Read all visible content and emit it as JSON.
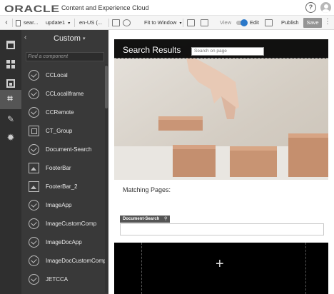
{
  "brand": {
    "logo_text": "ORACLE",
    "product_name": "Content and Experience Cloud",
    "help_icon": "help-icon",
    "avatar_icon": "user-avatar-icon"
  },
  "toolbar": {
    "back_glyph": "‹",
    "page_name": "sear...",
    "update": "update1",
    "update_caret": "▾",
    "locale": "en-US (...",
    "fit": "Fit to Window",
    "fit_caret": "▾",
    "view_label": "View",
    "edit_label": "Edit",
    "publish_label": "Publish",
    "save_label": "Save",
    "more_glyph": "⋮",
    "colors": {
      "toggle_on": "#2a78c9",
      "save_bg": "#949494"
    }
  },
  "rail": {
    "items": [
      {
        "name": "layout",
        "icon": "layout-icon"
      },
      {
        "name": "grid",
        "icon": "grid-icon"
      },
      {
        "name": "image",
        "icon": "image-icon"
      },
      {
        "name": "components",
        "icon": "crop-icon",
        "glyph": "⌗",
        "active": true
      },
      {
        "name": "theme",
        "icon": "brush-icon",
        "glyph": "✎"
      },
      {
        "name": "settings",
        "icon": "gear-icon",
        "glyph": "✹"
      }
    ]
  },
  "panel": {
    "collapse_glyph": "‹",
    "title": "Custom",
    "title_caret": "▾",
    "find_placeholder": "Find a component",
    "components": [
      {
        "label": "CCLocal",
        "icon": "check-circle-icon"
      },
      {
        "label": "CCLocalIframe",
        "icon": "check-circle-icon"
      },
      {
        "label": "CCRemote",
        "icon": "check-circle-icon"
      },
      {
        "label": "CT_Group",
        "icon": "group-icon"
      },
      {
        "label": "Document-Search",
        "icon": "check-circle-icon"
      },
      {
        "label": "FooterBar",
        "icon": "image-icon"
      },
      {
        "label": "FooterBar_2",
        "icon": "image-icon"
      },
      {
        "label": "ImageApp",
        "icon": "check-circle-icon"
      },
      {
        "label": "ImageCustomComp",
        "icon": "check-circle-icon"
      },
      {
        "label": "ImageDocApp",
        "icon": "check-circle-icon"
      },
      {
        "label": "ImageDocCustomComp",
        "icon": "check-circle-icon"
      },
      {
        "label": "JETCCA",
        "icon": "check-circle-icon"
      }
    ]
  },
  "canvas": {
    "search_title": "Search Results",
    "search_placeholder": "Search on page",
    "matching_label": "Matching Pages:",
    "doc_search_tag": "Document-Search",
    "doc_search_tag_icon": "⚲",
    "add_glyph": "+"
  }
}
